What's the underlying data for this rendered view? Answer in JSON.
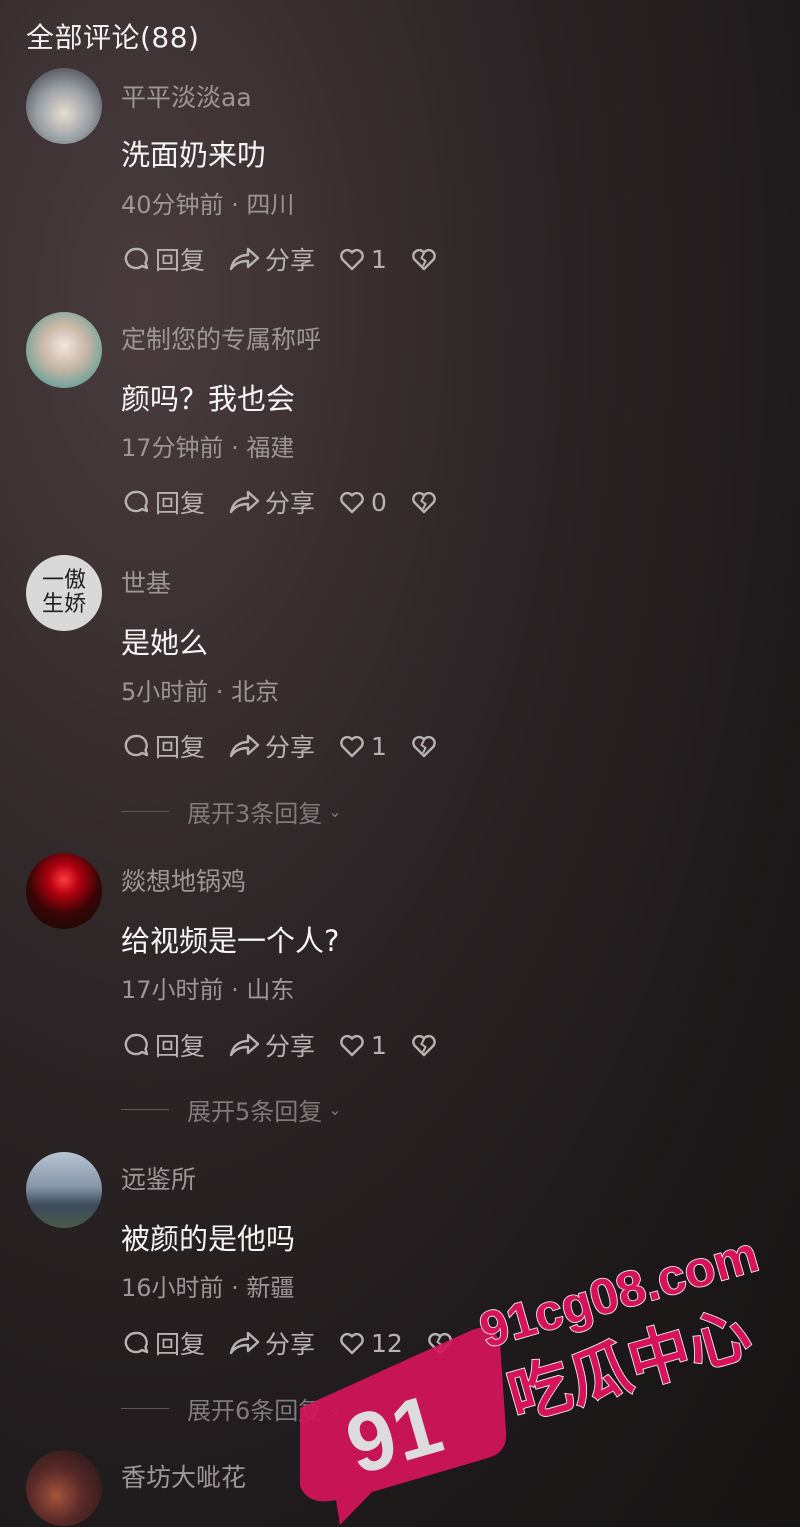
{
  "header": {
    "title": "全部评论(88)"
  },
  "actions": {
    "reply": "回复",
    "share": "分享"
  },
  "comments": [
    {
      "user": "平平淡淡aa",
      "text": "洗面奶来叻",
      "meta": "40分钟前 · 四川",
      "likes": "1"
    },
    {
      "user": "定制您的专属称呼",
      "text": "颜吗？我也会",
      "meta": "17分钟前 · 福建",
      "likes": "0"
    },
    {
      "user": "世基",
      "avatar_text": "一傲生娇",
      "text": "是她么",
      "meta": "5小时前 · 北京",
      "likes": "1",
      "expand": "展开3条回复"
    },
    {
      "user": "燚想地锅鸡",
      "text": "给视频是一个人?",
      "meta": "17小时前 · 山东",
      "likes": "1",
      "expand": "展开5条回复"
    },
    {
      "user": "远鉴所",
      "text": "被颜的是他吗",
      "meta": "16小时前 · 新疆",
      "likes": "12",
      "expand": "展开6条回复"
    },
    {
      "user": "香坊大呲花",
      "text": ""
    }
  ],
  "watermark": {
    "number": "91",
    "domain": "91cg08.com",
    "name": "吃瓜中心",
    "color": "#d6135a"
  }
}
